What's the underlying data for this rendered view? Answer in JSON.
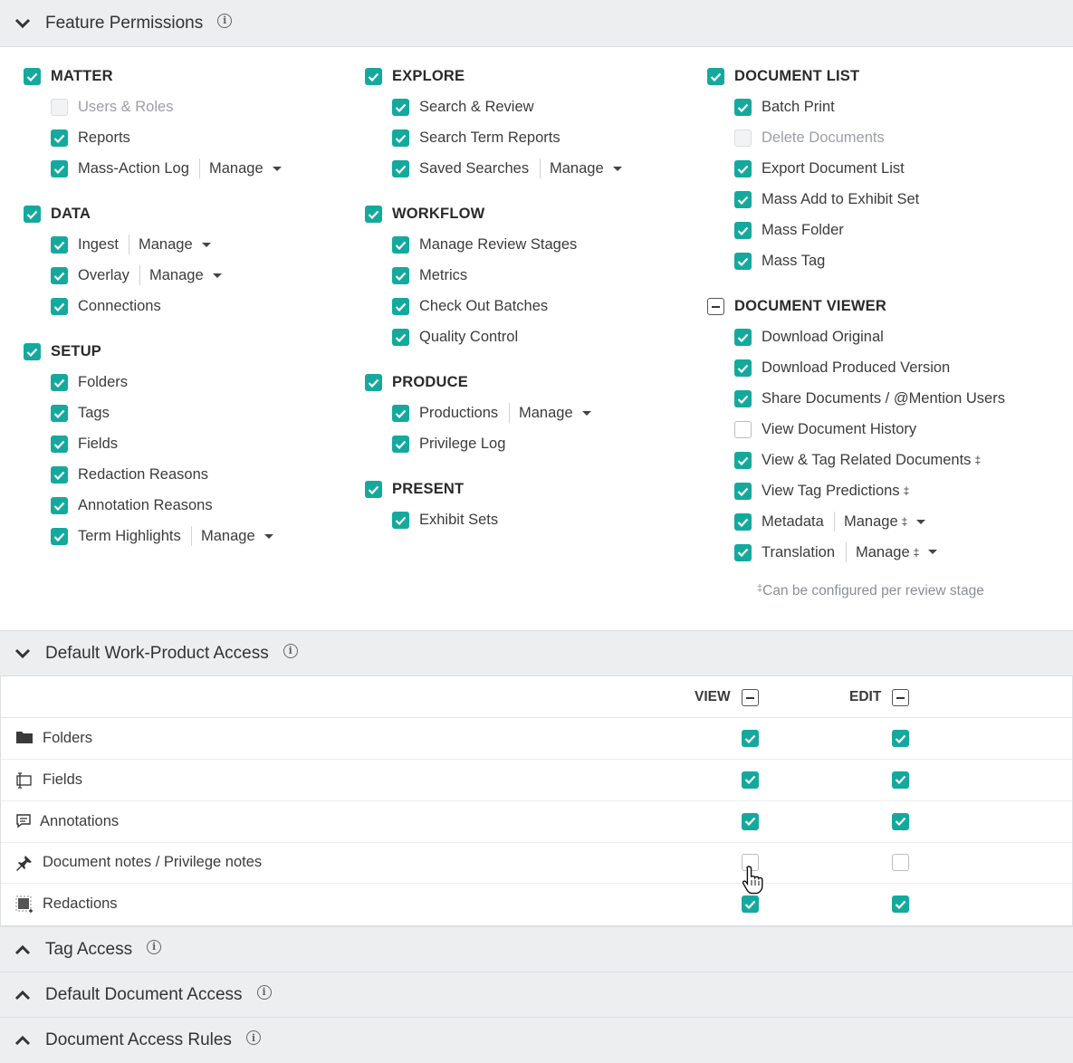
{
  "sections": {
    "feature_permissions": {
      "title": "Feature Permissions",
      "expanded": true
    },
    "default_work_product": {
      "title": "Default Work-Product Access",
      "expanded": true
    },
    "tag_access": {
      "title": "Tag Access",
      "expanded": false
    },
    "default_document_access": {
      "title": "Default Document Access",
      "expanded": false
    },
    "document_access_rules": {
      "title": "Document Access Rules",
      "expanded": false
    }
  },
  "manage_label": "Manage",
  "dagger": "‡",
  "footnote": "Can be configured per review stage",
  "groups": {
    "matter": {
      "label": "MATTER",
      "state": "checked",
      "items": [
        {
          "label": "Users & Roles",
          "state": "disabled"
        },
        {
          "label": "Reports",
          "state": "checked"
        },
        {
          "label": "Mass-Action Log",
          "state": "checked",
          "manage": true
        }
      ]
    },
    "data": {
      "label": "DATA",
      "state": "checked",
      "items": [
        {
          "label": "Ingest",
          "state": "checked",
          "manage": true
        },
        {
          "label": "Overlay",
          "state": "checked",
          "manage": true
        },
        {
          "label": "Connections",
          "state": "checked"
        }
      ]
    },
    "setup": {
      "label": "SETUP",
      "state": "checked",
      "items": [
        {
          "label": "Folders",
          "state": "checked"
        },
        {
          "label": "Tags",
          "state": "checked"
        },
        {
          "label": "Fields",
          "state": "checked"
        },
        {
          "label": "Redaction Reasons",
          "state": "checked"
        },
        {
          "label": "Annotation Reasons",
          "state": "checked"
        },
        {
          "label": "Term Highlights",
          "state": "checked",
          "manage": true
        }
      ]
    },
    "explore": {
      "label": "EXPLORE",
      "state": "checked",
      "items": [
        {
          "label": "Search & Review",
          "state": "checked"
        },
        {
          "label": "Search Term Reports",
          "state": "checked"
        },
        {
          "label": "Saved Searches",
          "state": "checked",
          "manage": true
        }
      ]
    },
    "workflow": {
      "label": "WORKFLOW",
      "state": "checked",
      "items": [
        {
          "label": "Manage Review Stages",
          "state": "checked"
        },
        {
          "label": "Metrics",
          "state": "checked"
        },
        {
          "label": "Check Out Batches",
          "state": "checked"
        },
        {
          "label": "Quality Control",
          "state": "checked"
        }
      ]
    },
    "produce": {
      "label": "PRODUCE",
      "state": "checked",
      "items": [
        {
          "label": "Productions",
          "state": "checked",
          "manage": true
        },
        {
          "label": "Privilege Log",
          "state": "checked"
        }
      ]
    },
    "present": {
      "label": "PRESENT",
      "state": "checked",
      "items": [
        {
          "label": "Exhibit Sets",
          "state": "checked"
        }
      ]
    },
    "document_list": {
      "label": "DOCUMENT LIST",
      "state": "checked",
      "items": [
        {
          "label": "Batch Print",
          "state": "checked"
        },
        {
          "label": "Delete Documents",
          "state": "disabled"
        },
        {
          "label": "Export Document List",
          "state": "checked"
        },
        {
          "label": "Mass Add to Exhibit Set",
          "state": "checked"
        },
        {
          "label": "Mass Folder",
          "state": "checked"
        },
        {
          "label": "Mass Tag",
          "state": "checked"
        }
      ]
    },
    "document_viewer": {
      "label": "DOCUMENT VIEWER",
      "state": "partial",
      "items": [
        {
          "label": "Download Original",
          "state": "checked"
        },
        {
          "label": "Download Produced Version",
          "state": "checked"
        },
        {
          "label": "Share Documents / @Mention Users",
          "state": "checked"
        },
        {
          "label": "View Document History",
          "state": "unchecked"
        },
        {
          "label": "View & Tag Related Documents",
          "state": "checked",
          "dagger": true
        },
        {
          "label": "View Tag Predictions",
          "state": "checked",
          "dagger": true
        },
        {
          "label": "Metadata",
          "state": "checked",
          "manage": true,
          "manage_dagger": true
        },
        {
          "label": "Translation",
          "state": "checked",
          "manage": true,
          "manage_dagger": true
        }
      ]
    }
  },
  "work_product": {
    "columns": {
      "view": "VIEW",
      "edit": "EDIT"
    },
    "rows": [
      {
        "label": "Folders",
        "icon": "folder-icon",
        "view": true,
        "edit": true
      },
      {
        "label": "Fields",
        "icon": "field-icon",
        "view": true,
        "edit": true
      },
      {
        "label": "Annotations",
        "icon": "comment-icon",
        "view": true,
        "edit": true
      },
      {
        "label": "Document notes / Privilege notes",
        "icon": "pin-icon",
        "view": false,
        "edit": false
      },
      {
        "label": "Redactions",
        "icon": "redaction-icon",
        "view": true,
        "edit": true
      }
    ]
  },
  "colors": {
    "accent": "#15a99e",
    "header_bg": "#eceef0"
  }
}
